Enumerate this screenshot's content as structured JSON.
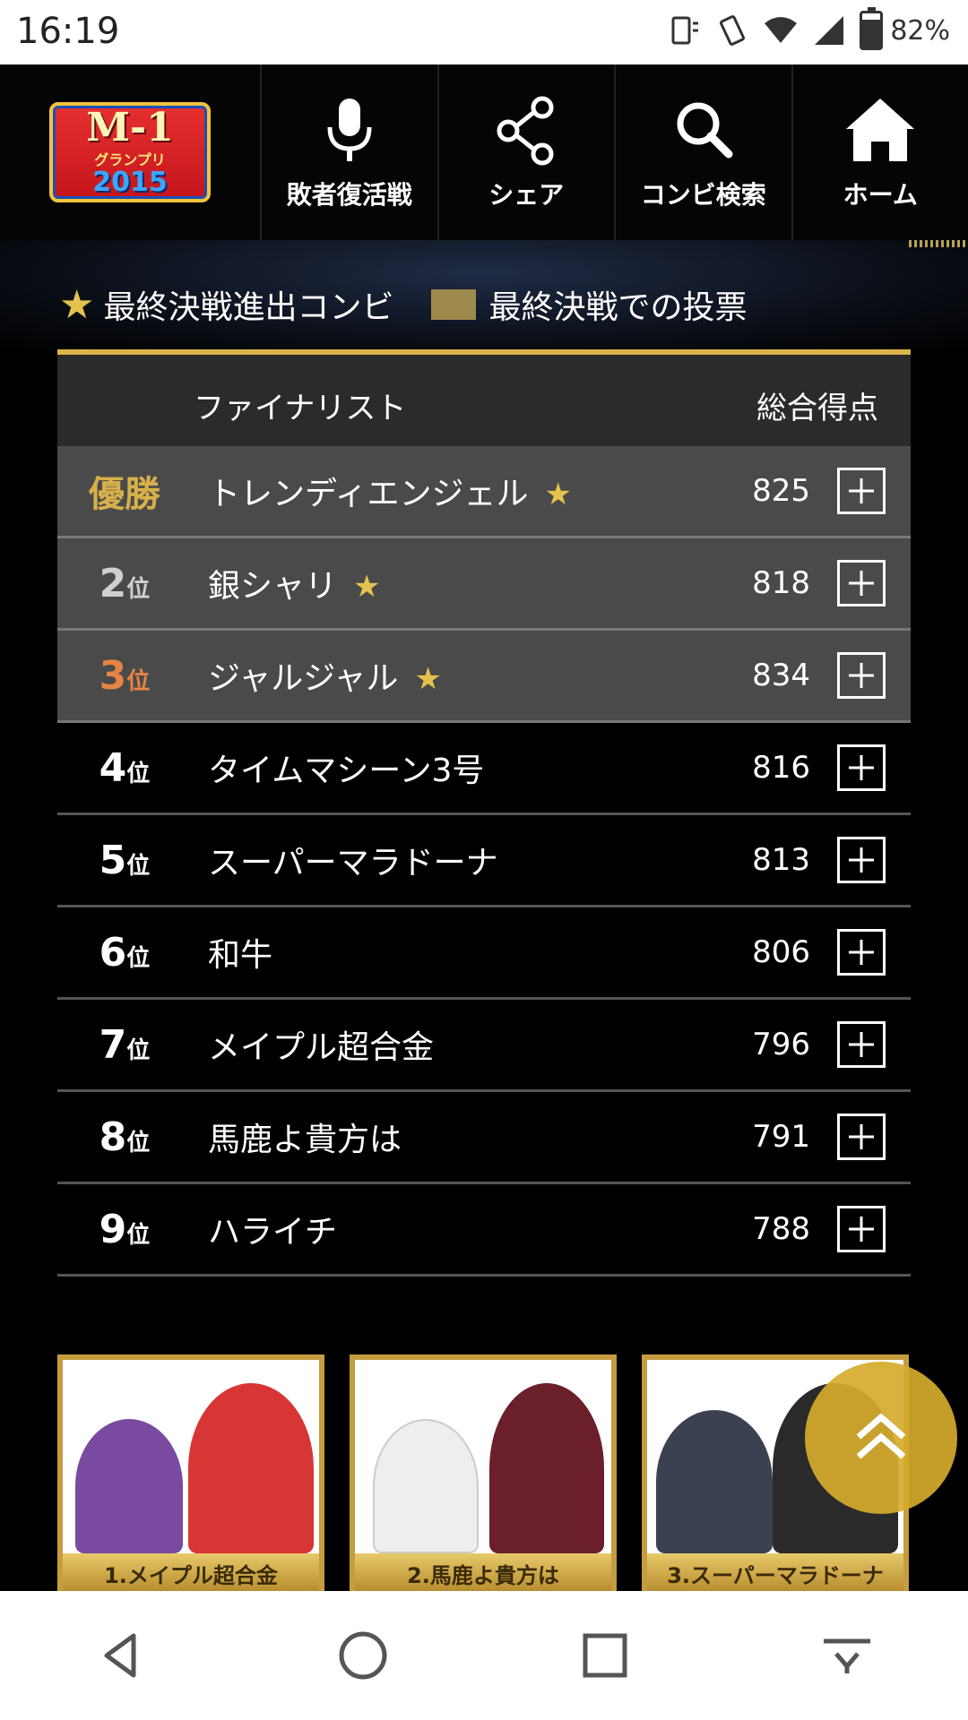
{
  "status_bar": {
    "time": "16:19",
    "battery": "82%",
    "battery_level": 0.82
  },
  "header": {
    "logo_text": "M-1",
    "logo_sub": "グランプリ",
    "logo_year": "2015",
    "nav": [
      {
        "label": "敗者復活戦",
        "icon": "microphone-icon"
      },
      {
        "label": "シェア",
        "icon": "share-icon"
      },
      {
        "label": "コンビ検索",
        "icon": "search-icon"
      },
      {
        "label": "ホーム",
        "icon": "home-icon"
      }
    ]
  },
  "legend": {
    "finalist_label": "最終決戦進出コンビ",
    "vote_label": "最終決戦での投票"
  },
  "table": {
    "col_finalist": "ファイナリスト",
    "col_score": "総合得点",
    "rows": [
      {
        "rank": "優勝",
        "name": "トレンディエンジェル",
        "score": "825",
        "final": true
      },
      {
        "rank": "2",
        "suffix": "位",
        "name": "銀シャリ",
        "score": "818",
        "final": true
      },
      {
        "rank": "3",
        "suffix": "位",
        "name": "ジャルジャル",
        "score": "834",
        "final": true
      },
      {
        "rank": "4",
        "suffix": "位",
        "name": "タイムマシーン3号",
        "score": "816",
        "final": false
      },
      {
        "rank": "5",
        "suffix": "位",
        "name": "スーパーマラドーナ",
        "score": "813",
        "final": false
      },
      {
        "rank": "6",
        "suffix": "位",
        "name": "和牛",
        "score": "806",
        "final": false
      },
      {
        "rank": "7",
        "suffix": "位",
        "name": "メイプル超合金",
        "score": "796",
        "final": false
      },
      {
        "rank": "8",
        "suffix": "位",
        "name": "馬鹿よ貴方は",
        "score": "791",
        "final": false
      },
      {
        "rank": "9",
        "suffix": "位",
        "name": "ハライチ",
        "score": "788",
        "final": false
      }
    ]
  },
  "cards": [
    {
      "caption": "1.メイプル超合金"
    },
    {
      "caption": "2.馬鹿よ貴方は"
    },
    {
      "caption": "3.スーパーマラドーナ"
    }
  ],
  "colors": {
    "gold": "#d9b44a",
    "star": "#e4c24e",
    "top_row": "#4a4a4a",
    "scroll_top": "#d6aa2c"
  }
}
